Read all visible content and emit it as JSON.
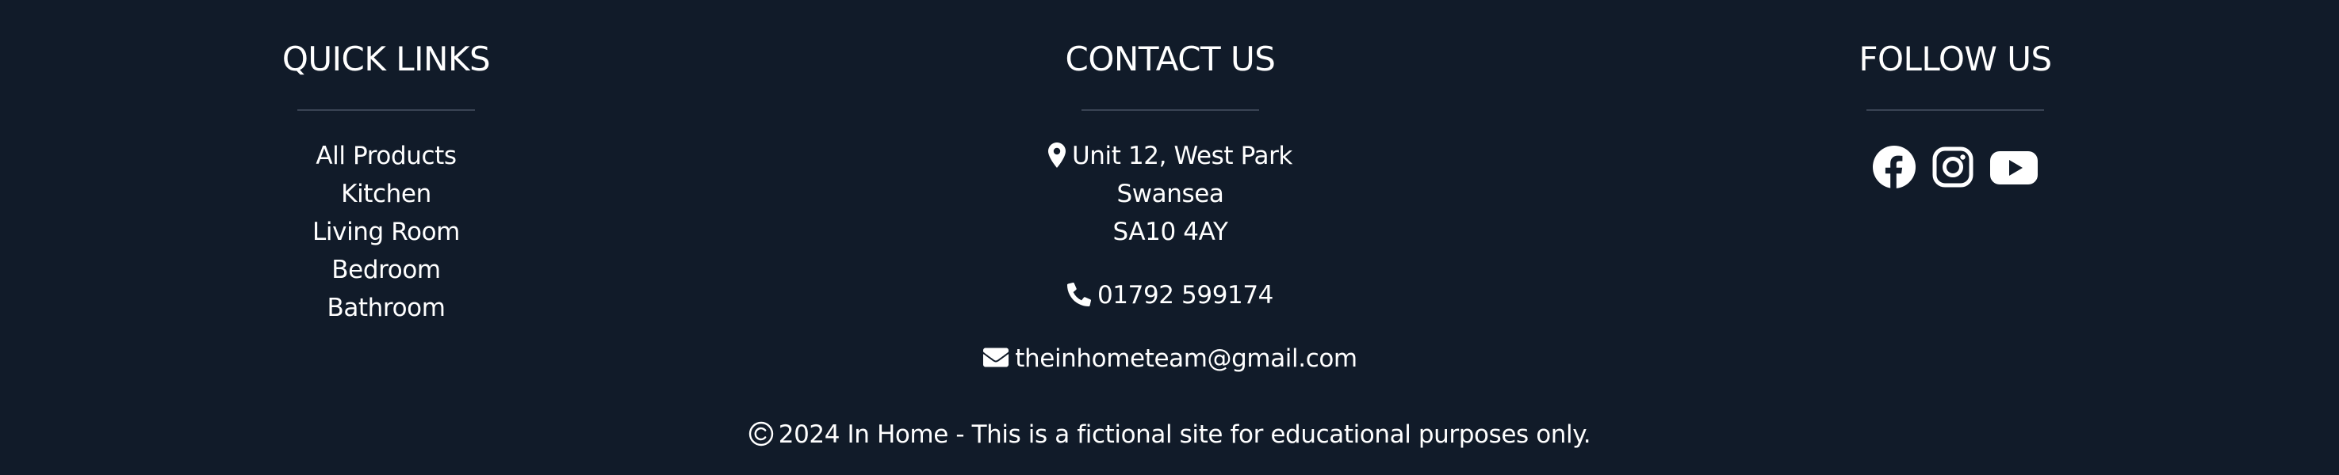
{
  "quick_links": {
    "heading": "QUICK LINKS",
    "items": [
      {
        "label": "All Products"
      },
      {
        "label": "Kitchen"
      },
      {
        "label": "Living Room"
      },
      {
        "label": "Bedroom"
      },
      {
        "label": "Bathroom"
      }
    ]
  },
  "contact": {
    "heading": "CONTACT US",
    "address_icon": "map-marker-icon",
    "address_lines": [
      "Unit 12, West Park",
      "Swansea",
      "SA10 4AY"
    ],
    "phone_icon": "phone-icon",
    "phone": "01792 599174",
    "email_icon": "envelope-icon",
    "email": "theinhometeam@gmail.com"
  },
  "follow": {
    "heading": "FOLLOW US",
    "icons": [
      "facebook-icon",
      "instagram-icon",
      "youtube-icon"
    ]
  },
  "copyright": {
    "icon": "copyright-icon",
    "text": "2024 In Home - This is a fictional site for educational purposes only."
  },
  "colors": {
    "background": "#111b29",
    "text": "#ffffff",
    "divider": "#3a4454"
  }
}
